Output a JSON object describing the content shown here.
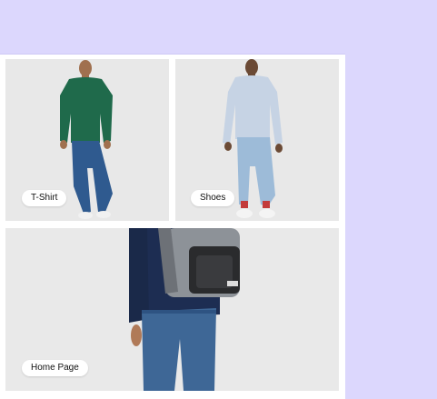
{
  "categories": [
    {
      "label": "T-Shirt"
    },
    {
      "label": "Shoes"
    },
    {
      "label": "Home Page"
    }
  ],
  "colors": {
    "page_background": "#dcd7fd",
    "panel_background": "#ffffff",
    "card_background": "#e9e9e9"
  }
}
